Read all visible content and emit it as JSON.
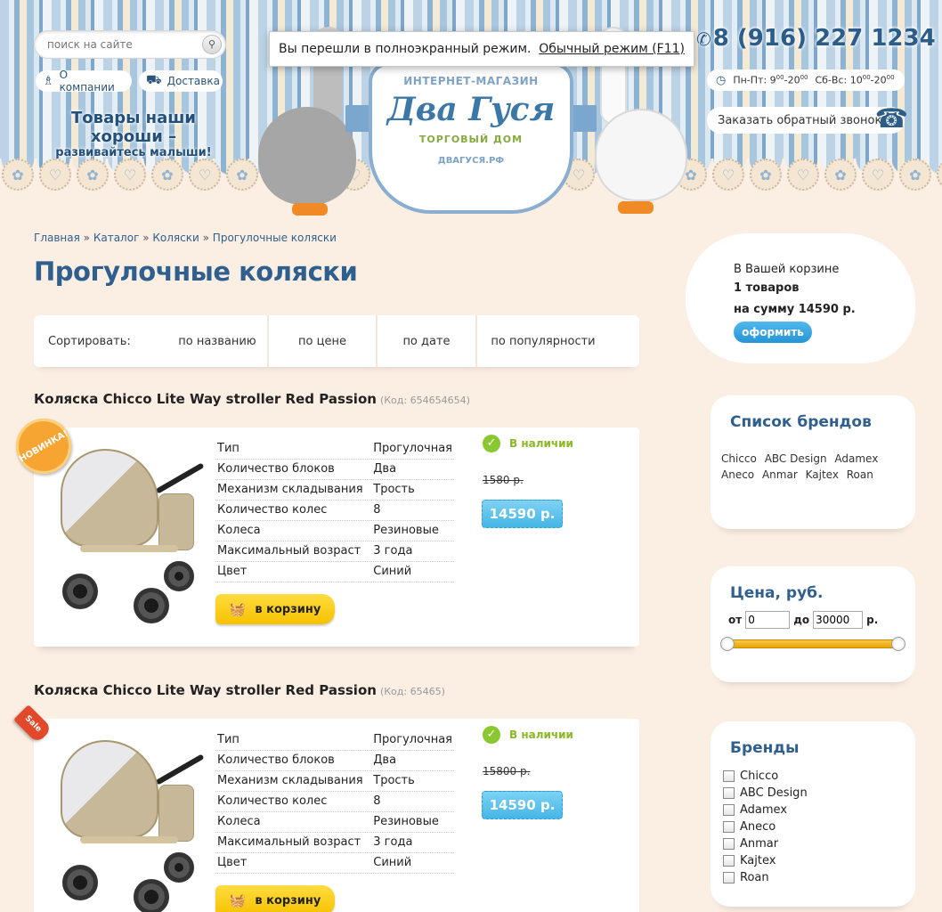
{
  "colors": {
    "brand_blue": "#2f5f8e",
    "accent_yellow": "#f6c200",
    "price_blue": "#45b6e6",
    "in_stock_green": "#8ab925",
    "background": "#fbeee3"
  },
  "fullscreen_notice": {
    "message": "Вы перешли в полноэкранный режим.",
    "link": "Обычный режим (F11)"
  },
  "header": {
    "search_placeholder": "поиск на сайте",
    "nav": {
      "about": "О компании",
      "delivery": "Доставка"
    },
    "slogan_line1": "Товары наши хороши –",
    "slogan_line2": "развивайтесь малыши!",
    "logo": {
      "shop_type": "ИНТЕРНЕТ-МАГАЗИН",
      "name": "Два Гуся",
      "subtitle": "ТОРГОВЫЙ ДОМ",
      "domain": "ДВАГУСЯ.РФ"
    },
    "phone": "8 (916) 227 1234",
    "hours": {
      "weekdays_label": "Пн-Пт:",
      "weekdays_from": "9",
      "weekdays_from_sup": "00",
      "weekdays_to": "20",
      "weekdays_to_sup": "00",
      "weekend_label": "Сб-Вс:",
      "weekend_from": "10",
      "weekend_from_sup": "00",
      "weekend_to": "20",
      "weekend_to_sup": "00"
    },
    "callback": "Заказать обратный звонок"
  },
  "breadcrumb": {
    "home": "Главная",
    "catalog": "Каталог",
    "strollers": "Коляски",
    "current": "Прогулочные коляски",
    "separator": "»"
  },
  "page_title": "Прогулочные коляски",
  "sort": {
    "label": "Сортировать:",
    "by_name": "по названию",
    "by_price": "по цене",
    "by_date": "по дате",
    "by_popularity": "по популярности"
  },
  "products": [
    {
      "title": "Коляска Chicco Lite Way stroller Red Passion",
      "code": "(Код: 654654654)",
      "badge": "НОВИНКА!",
      "specs": [
        {
          "k": "Тип",
          "v": "Прогулочная"
        },
        {
          "k": "Количество блоков",
          "v": "Два"
        },
        {
          "k": "Механизм складывания",
          "v": "Трость"
        },
        {
          "k": "Количество колес",
          "v": "8"
        },
        {
          "k": "Колеса",
          "v": "Резиновые"
        },
        {
          "k": "Максимальный возраст",
          "v": "3 года"
        },
        {
          "k": "Цвет",
          "v": "Синий"
        }
      ],
      "availability": "В наличии",
      "old_price": "1580 р.",
      "price": "14590 р.",
      "cart_button": "в корзину"
    },
    {
      "title": "Коляска Chicco Lite Way stroller Red Passion",
      "code": "(Код: 65465)",
      "badge": "Sale",
      "specs": [
        {
          "k": "Тип",
          "v": "Прогулочная"
        },
        {
          "k": "Количество блоков",
          "v": "Два"
        },
        {
          "k": "Механизм складывания",
          "v": "Трость"
        },
        {
          "k": "Количество колес",
          "v": "8"
        },
        {
          "k": "Колеса",
          "v": "Резиновые"
        },
        {
          "k": "Максимальный возраст",
          "v": "3 года"
        },
        {
          "k": "Цвет",
          "v": "Синий"
        }
      ],
      "availability": "В наличии",
      "old_price": "15800 р.",
      "price": "14590 р.",
      "cart_button": "в корзину"
    }
  ],
  "cart": {
    "line1": "В Вашей корзине",
    "count": "1 товаров",
    "sum": "на сумму 14590 р.",
    "checkout": "оформить"
  },
  "brands_box": {
    "title": "Список брендов",
    "items": [
      "Chicco",
      "ABC Design",
      "Adamex",
      "Aneco",
      "Anmar",
      "Kajtex",
      "Roan"
    ]
  },
  "price_filter": {
    "title": "Цена, руб.",
    "from_label": "от",
    "from_value": "0",
    "to_label": "до",
    "to_value": "30000",
    "unit": "р.",
    "range_min": 0,
    "range_max": 30000
  },
  "brands_filter": {
    "title": "Бренды",
    "items": [
      "Chicco",
      "ABC Design",
      "Adamex",
      "Aneco",
      "Anmar",
      "Kajtex",
      "Roan"
    ]
  }
}
